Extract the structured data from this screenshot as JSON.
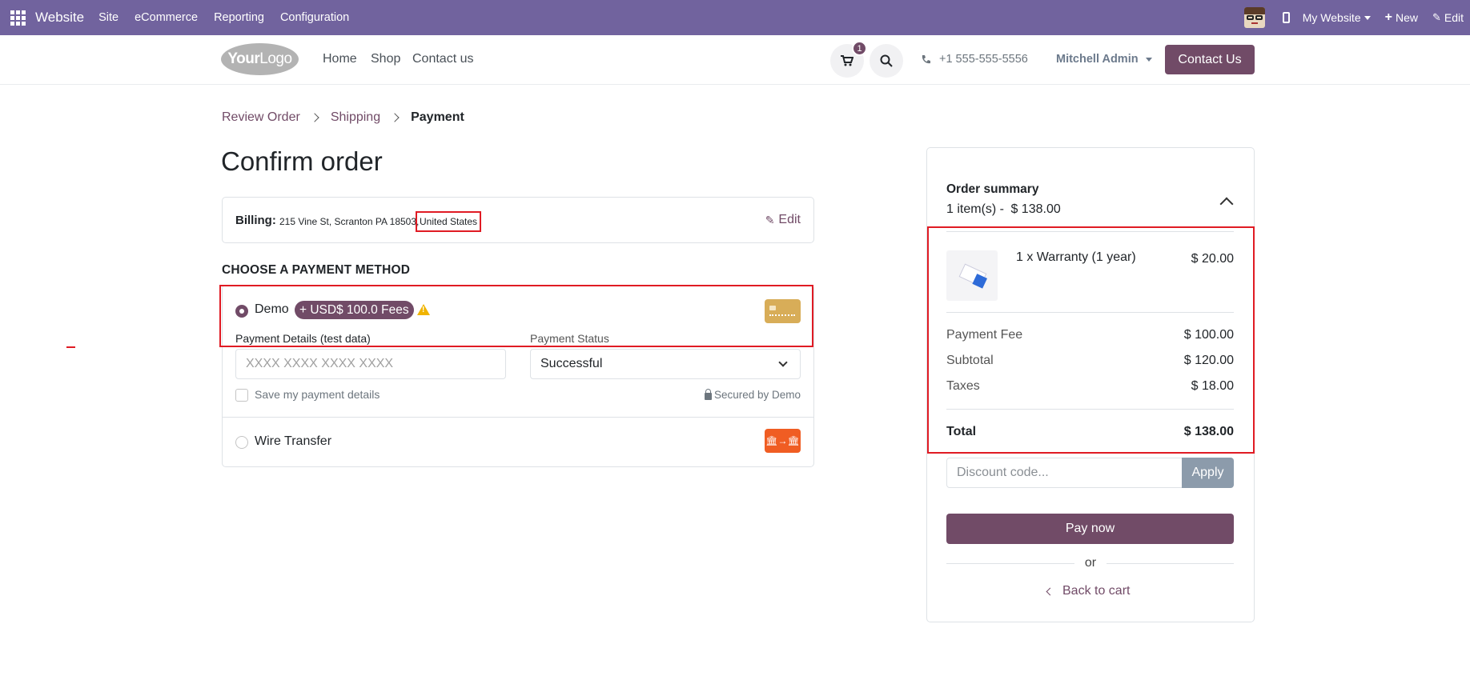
{
  "admin_bar": {
    "brand": "Website",
    "menus": [
      "Site",
      "eCommerce",
      "Reporting",
      "Configuration"
    ],
    "my_website": "My Website",
    "new_label": "New",
    "edit_label": "Edit"
  },
  "header": {
    "logo_bold": "Your",
    "logo_rest": "Logo",
    "nav": [
      "Home",
      "Shop",
      "Contact us"
    ],
    "cart_count": "1",
    "phone": "+1 555-555-5556",
    "user": "Mitchell Admin",
    "contact_button": "Contact Us"
  },
  "breadcrumb": {
    "step1": "Review Order",
    "step2": "Shipping",
    "step3": "Payment"
  },
  "page_title": "Confirm order",
  "billing": {
    "label": "Billing:",
    "address": "215 Vine St, Scranton PA 18503,",
    "country": "United States",
    "edit": "Edit"
  },
  "payment": {
    "section_title": "CHOOSE A PAYMENT METHOD",
    "demo": {
      "label": "Demo",
      "fee_badge": "+ USD$ 100.0 Fees",
      "details_label": "Payment Details (test data)",
      "card_placeholder": "XXXX XXXX XXXX XXXX",
      "status_label": "Payment Status",
      "status_value": "Successful",
      "save_label": "Save my payment details",
      "secured": "Secured by Demo"
    },
    "wire": {
      "label": "Wire Transfer"
    }
  },
  "summary": {
    "title": "Order summary",
    "items_count": "1 item(s) -",
    "items_total": "$ 138.00",
    "product": {
      "name": "1 x Warranty (1 year)",
      "price": "$ 20.00"
    },
    "rows": [
      {
        "label": "Payment Fee",
        "value": "$ 100.00"
      },
      {
        "label": "Subtotal",
        "value": "$ 120.00"
      },
      {
        "label": "Taxes",
        "value": "$ 18.00"
      }
    ],
    "total_label": "Total",
    "total_value": "$ 138.00",
    "discount_placeholder": "Discount code...",
    "apply": "Apply",
    "pay_now": "Pay now",
    "or": "or",
    "back_to_cart": "Back to cart"
  }
}
